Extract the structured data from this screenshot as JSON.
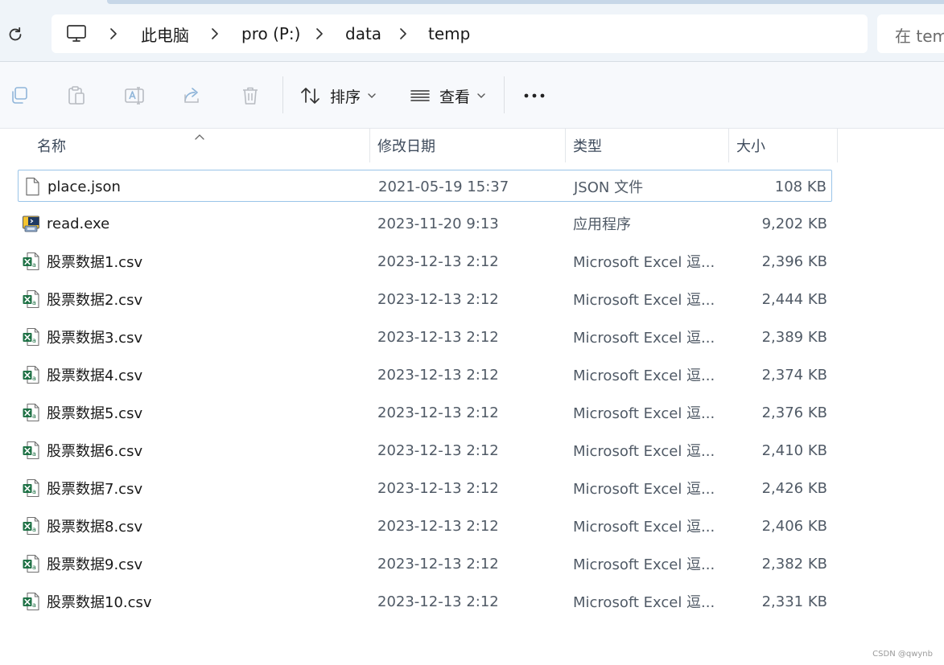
{
  "breadcrumb": {
    "items": [
      "此电脑",
      "pro (P:)",
      "data",
      "temp"
    ]
  },
  "search": {
    "placeholder": "在 temp 中搜索"
  },
  "toolbar": {
    "sort_label": "排序",
    "view_label": "查看"
  },
  "columns": {
    "name": "名称",
    "date": "修改日期",
    "type": "类型",
    "size": "大小"
  },
  "files": [
    {
      "icon": "json-file-icon",
      "name": "place.json",
      "date": "2021-05-19 15:37",
      "type": "JSON 文件",
      "size": "108 KB",
      "selected": true
    },
    {
      "icon": "exe-file-icon",
      "name": "read.exe",
      "date": "2023-11-20 9:13",
      "type": "应用程序",
      "size": "9,202 KB"
    },
    {
      "icon": "excel-file-icon",
      "name": "股票数据1.csv",
      "date": "2023-12-13 2:12",
      "type": "Microsoft Excel 逗...",
      "size": "2,396 KB"
    },
    {
      "icon": "excel-file-icon",
      "name": "股票数据2.csv",
      "date": "2023-12-13 2:12",
      "type": "Microsoft Excel 逗...",
      "size": "2,444 KB"
    },
    {
      "icon": "excel-file-icon",
      "name": "股票数据3.csv",
      "date": "2023-12-13 2:12",
      "type": "Microsoft Excel 逗...",
      "size": "2,389 KB"
    },
    {
      "icon": "excel-file-icon",
      "name": "股票数据4.csv",
      "date": "2023-12-13 2:12",
      "type": "Microsoft Excel 逗...",
      "size": "2,374 KB"
    },
    {
      "icon": "excel-file-icon",
      "name": "股票数据5.csv",
      "date": "2023-12-13 2:12",
      "type": "Microsoft Excel 逗...",
      "size": "2,376 KB"
    },
    {
      "icon": "excel-file-icon",
      "name": "股票数据6.csv",
      "date": "2023-12-13 2:12",
      "type": "Microsoft Excel 逗...",
      "size": "2,410 KB"
    },
    {
      "icon": "excel-file-icon",
      "name": "股票数据7.csv",
      "date": "2023-12-13 2:12",
      "type": "Microsoft Excel 逗...",
      "size": "2,426 KB"
    },
    {
      "icon": "excel-file-icon",
      "name": "股票数据8.csv",
      "date": "2023-12-13 2:12",
      "type": "Microsoft Excel 逗...",
      "size": "2,406 KB"
    },
    {
      "icon": "excel-file-icon",
      "name": "股票数据9.csv",
      "date": "2023-12-13 2:12",
      "type": "Microsoft Excel 逗...",
      "size": "2,382 KB"
    },
    {
      "icon": "excel-file-icon",
      "name": "股票数据10.csv",
      "date": "2023-12-13 2:12",
      "type": "Microsoft Excel 逗...",
      "size": "2,331 KB"
    }
  ],
  "watermark": "CSDN @qwynb",
  "colors": {
    "selection_border": "#9ac4e8",
    "excel_green": "#1e7145",
    "address_bg": "#eff4f9"
  }
}
